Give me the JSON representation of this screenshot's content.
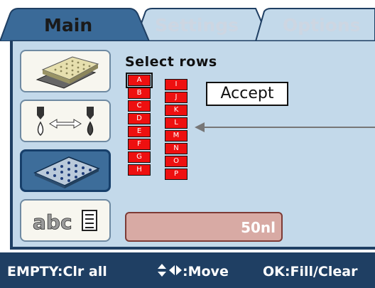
{
  "tabs": [
    {
      "label": "Main",
      "active": true
    },
    {
      "label": "Settings",
      "active": false
    },
    {
      "label": "Options",
      "active": false
    }
  ],
  "sidebar": {
    "items": [
      {
        "icon": "plate-stack-icon",
        "active": false
      },
      {
        "icon": "dispense-transfer-icon",
        "active": false
      },
      {
        "icon": "microplate-icon",
        "active": true
      },
      {
        "icon": "abc-text-icon",
        "label": "abc",
        "active": false
      }
    ]
  },
  "main": {
    "title": "Select rows",
    "rows_left": [
      "A",
      "B",
      "C",
      "D",
      "E",
      "F",
      "G",
      "H"
    ],
    "rows_right": [
      "I",
      "J",
      "K",
      "L",
      "M",
      "N",
      "O",
      "P"
    ],
    "selected_row": "A",
    "accept_label": "Accept",
    "volume": "50nl"
  },
  "status_bar": {
    "empty": "EMPTY:Clr all",
    "move": ":Move",
    "ok": "OK:Fill/Clear"
  },
  "colors": {
    "panel": "#c3d9ea",
    "dark_blue": "#1f3f63",
    "row_red": "#ee1010",
    "volume_bg": "#d8aaa4"
  }
}
